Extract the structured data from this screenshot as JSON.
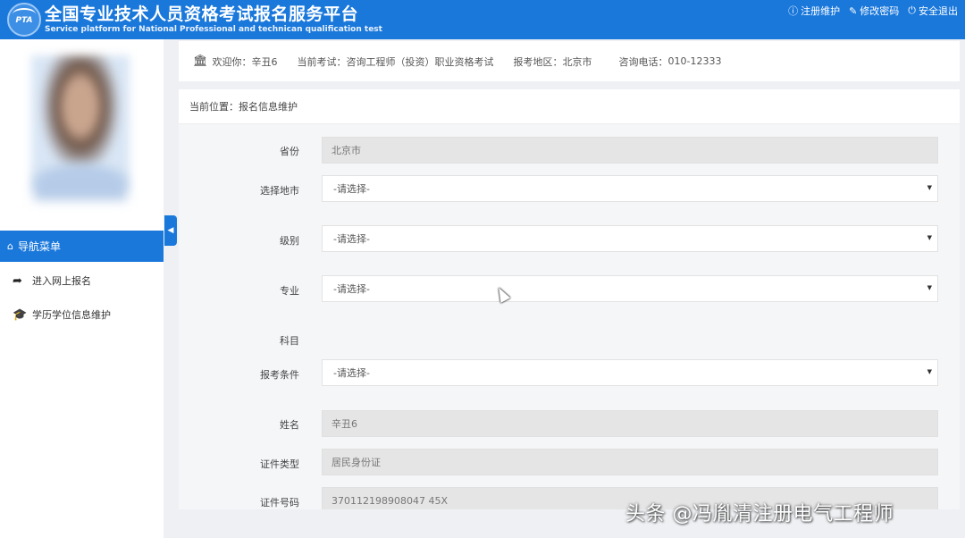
{
  "header": {
    "logo_text": "PTA",
    "title": "全国专业技术人员资格考试报名服务平台",
    "subtitle": "Service platform for National Professional and technican qualification test",
    "links": [
      {
        "icon": "info-icon",
        "label": "注册维护"
      },
      {
        "icon": "edit-icon",
        "label": "修改密码"
      },
      {
        "icon": "power-icon",
        "label": "安全退出"
      }
    ]
  },
  "sidebar": {
    "nav_header": "导航菜单",
    "items": [
      {
        "icon": "share-arrow-icon",
        "label": "进入网上报名"
      },
      {
        "icon": "graduation-cap-icon",
        "label": "学历学位信息维护"
      }
    ]
  },
  "infobar": {
    "welcome_label": "欢迎你：",
    "welcome_value": "辛丑6",
    "exam_label": "当前考试：",
    "exam_value": "咨询工程师（投资）职业资格考试",
    "region_label": "报考地区：",
    "region_value": "北京市",
    "phone_label": "咨询电话：",
    "phone_value": "010-12333"
  },
  "breadcrumb": "当前位置：报名信息维护",
  "form": {
    "province_label": "省份",
    "province_value": "北京市",
    "city_label": "选择地市",
    "city_value": "-请选择-",
    "level_label": "级别",
    "level_value": "-请选择-",
    "major_label": "专业",
    "major_value": "-请选择-",
    "subject_label": "科目",
    "condition_label": "报考条件",
    "condition_value": "-请选择-",
    "name_label": "姓名",
    "name_value": "辛丑6",
    "id_type_label": "证件类型",
    "id_type_value": "居民身份证",
    "id_no_label": "证件号码",
    "id_no_value": "370112198908047 45X"
  },
  "watermark": "头条 @冯胤清注册电气工程师",
  "colors": {
    "brand": "#1a78db",
    "page_bg": "#eef0f3"
  }
}
